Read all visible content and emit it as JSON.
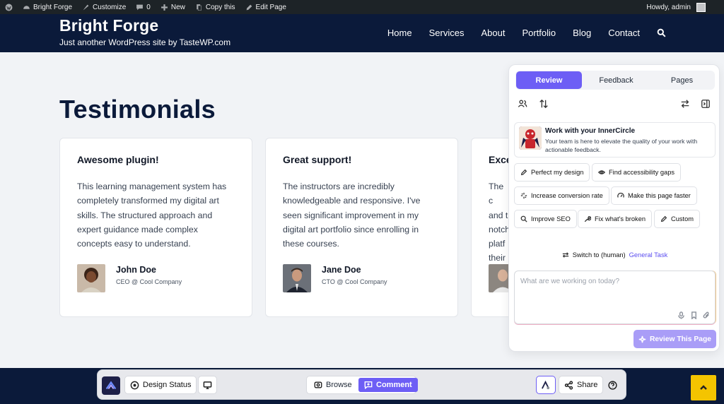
{
  "admin_bar": {
    "site_name": "Bright Forge",
    "customize": "Customize",
    "comments_count": "0",
    "new": "New",
    "copy": "Copy this",
    "edit": "Edit Page",
    "howdy": "Howdy, admin"
  },
  "header": {
    "site_title": "Bright Forge",
    "tagline": "Just another WordPress site by TasteWP.com",
    "nav": [
      "Home",
      "Services",
      "About",
      "Portfolio",
      "Blog",
      "Contact"
    ]
  },
  "page": {
    "title": "Testimonials",
    "cards": [
      {
        "title": "Awesome plugin!",
        "text": "This learning management system has completely transformed my digital art skills. The structured approach and expert guidance made complex concepts easy to understand.",
        "name": "John Doe",
        "role": "CEO @ Cool Company"
      },
      {
        "title": "Great support!",
        "text": "The instructors are incredibly knowledgeable and responsive. I've seen significant improvement in my digital art portfolio since enrolling in these courses.",
        "name": "Jane Doe",
        "role": "CTO @ Cool Company"
      },
      {
        "title": "Exce",
        "text": "The c and t notch platf their",
        "name": "",
        "role": ""
      }
    ]
  },
  "panel": {
    "tabs": [
      "Review",
      "Feedback",
      "Pages"
    ],
    "inner_circle": {
      "heading": "Work with your InnerCircle",
      "description": "Your team is here to elevate the quality of your work with actionable feedback."
    },
    "chips": [
      "Perfect my design",
      "Find accessibility gaps",
      "Increase conversion rate",
      "Make this page faster",
      "Improve SEO",
      "Fix what's broken",
      "Custom"
    ],
    "switch_text": "Switch to (human)",
    "switch_link": "General Task",
    "prompt_placeholder": "What are we working on today?",
    "review_button": "Review This Page"
  },
  "toolbar": {
    "design_status": "Design Status",
    "browse": "Browse",
    "comment": "Comment",
    "share": "Share"
  },
  "colors": {
    "accent": "#6d5ef5",
    "header_bg": "#0b1a3a",
    "scroll_top": "#f4c400"
  }
}
